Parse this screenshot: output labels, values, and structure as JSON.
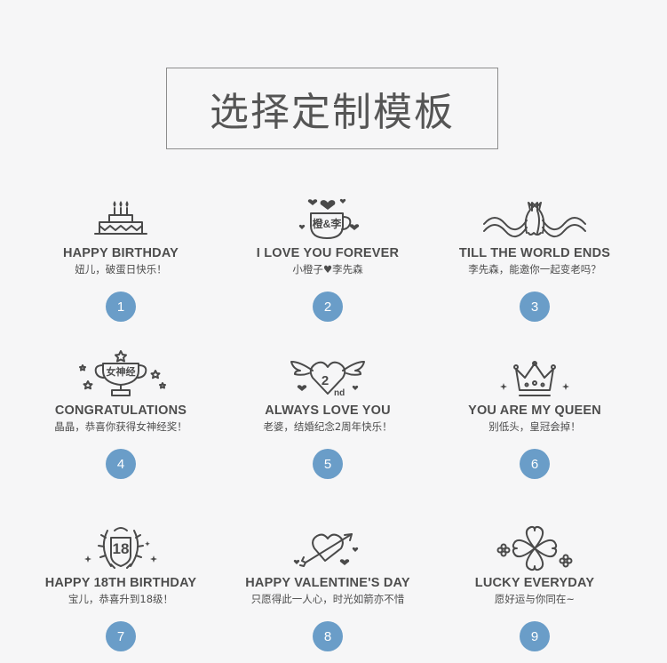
{
  "title": "选择定制模板",
  "accent_color": "#6a9dc8",
  "templates": [
    {
      "icon": "birthday-cake-icon",
      "en": "HAPPY BIRTHDAY",
      "zh": "妞儿，破蛋日快乐！",
      "num": "1"
    },
    {
      "icon": "coffee-cup-hearts-icon",
      "badge": "橙&李",
      "en": "I LOVE YOU FOREVER",
      "zh": "小橙子♥李先森",
      "num": "2"
    },
    {
      "icon": "two-cats-icon",
      "en": "TILL THE WORLD ENDS",
      "zh": "李先森，能邀你一起变老吗？",
      "num": "3"
    },
    {
      "icon": "trophy-icon",
      "badge": "女神经",
      "en": "CONGRATULATIONS",
      "zh": "晶晶，恭喜你获得女神经奖！",
      "num": "4"
    },
    {
      "icon": "winged-heart-icon",
      "badge": "2",
      "badge_sup": "nd",
      "en": "ALWAYS LOVE YOU",
      "zh": "老婆，结婚纪念2周年快乐！",
      "num": "5"
    },
    {
      "icon": "crown-icon",
      "en": "YOU ARE MY QUEEN",
      "zh": "别低头，皇冠会掉！",
      "num": "6"
    },
    {
      "icon": "laurel-badge-icon",
      "badge": "18",
      "en": "HAPPY 18TH BIRTHDAY",
      "zh": "宝儿，恭喜升到18级！",
      "num": "7"
    },
    {
      "icon": "arrow-heart-icon",
      "en": "HAPPY VALENTINE'S DAY",
      "zh": "只愿得此一人心，时光如箭亦不惜",
      "num": "8"
    },
    {
      "icon": "clover-icon",
      "en": "LUCKY EVERYDAY",
      "zh": "愿好运与你同在~",
      "num": "9"
    }
  ]
}
